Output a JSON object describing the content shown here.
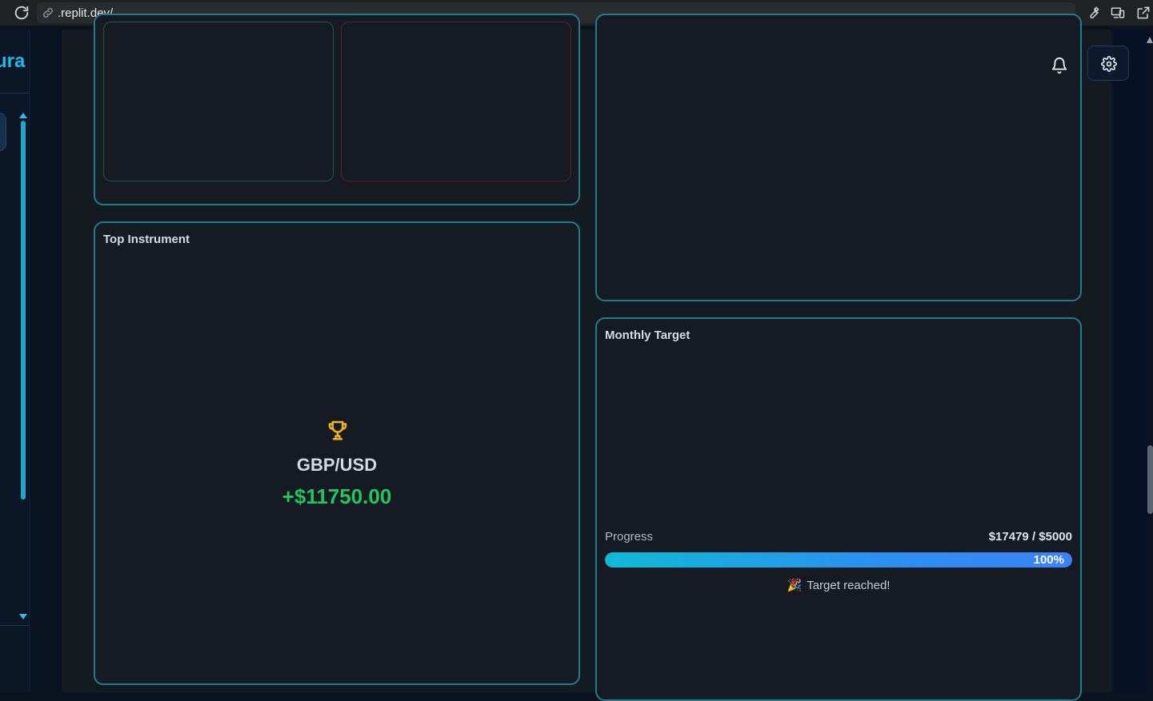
{
  "browser": {
    "url": ".replit.dev/"
  },
  "sidebar": {
    "brand": "ura"
  },
  "cards": {
    "top_instrument": {
      "title": "Top Instrument",
      "symbol": "GBP/USD",
      "pnl": "+$11750.00",
      "icon": "trophy-icon"
    },
    "monthly_target": {
      "title": "Monthly Target",
      "progress_label": "Progress",
      "progress_amount": "$17479 / $5000",
      "progress_percent_label": "100%",
      "progress_fraction": 1.0,
      "status_message": "Target reached!",
      "status_icon": "party-popper-icon"
    }
  },
  "colors": {
    "accent": "#22b9e6",
    "card_border": "#1f7d8f",
    "positive": "#22c55e",
    "trophy": "#f0b323"
  }
}
